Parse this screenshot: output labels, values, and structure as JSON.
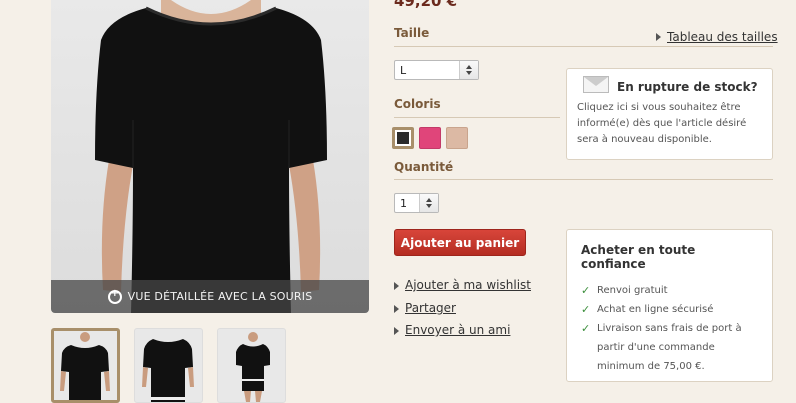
{
  "product": {
    "price": "49,20 €",
    "zoom_hint": "VUE DÉTAILLÉE AVEC LA SOURIS"
  },
  "size": {
    "label": "Taille",
    "chart_link": "Tableau des tailles",
    "selected": "L"
  },
  "color": {
    "label": "Coloris",
    "swatches": [
      "#2b2b2b",
      "#e0457a",
      "#dcb9a4"
    ]
  },
  "quantity": {
    "label": "Quantité",
    "selected": "1"
  },
  "cart_button": "Ajouter au panier",
  "actions": {
    "wishlist": "Ajouter à ma wishlist",
    "share": "Partager",
    "send": "Envoyer à un ami"
  },
  "stock": {
    "title": "En rupture de stock?",
    "text": "Cliquez ici si vous souhaitez être informé(e) dès que l'article désiré sera à nouveau disponible."
  },
  "trust": {
    "title": "Acheter en toute confiance",
    "items": [
      "Renvoi gratuit",
      "Achat en ligne sécurisé",
      "Livraison sans frais de port à partir d'une commande minimum de 75,00 €."
    ]
  }
}
